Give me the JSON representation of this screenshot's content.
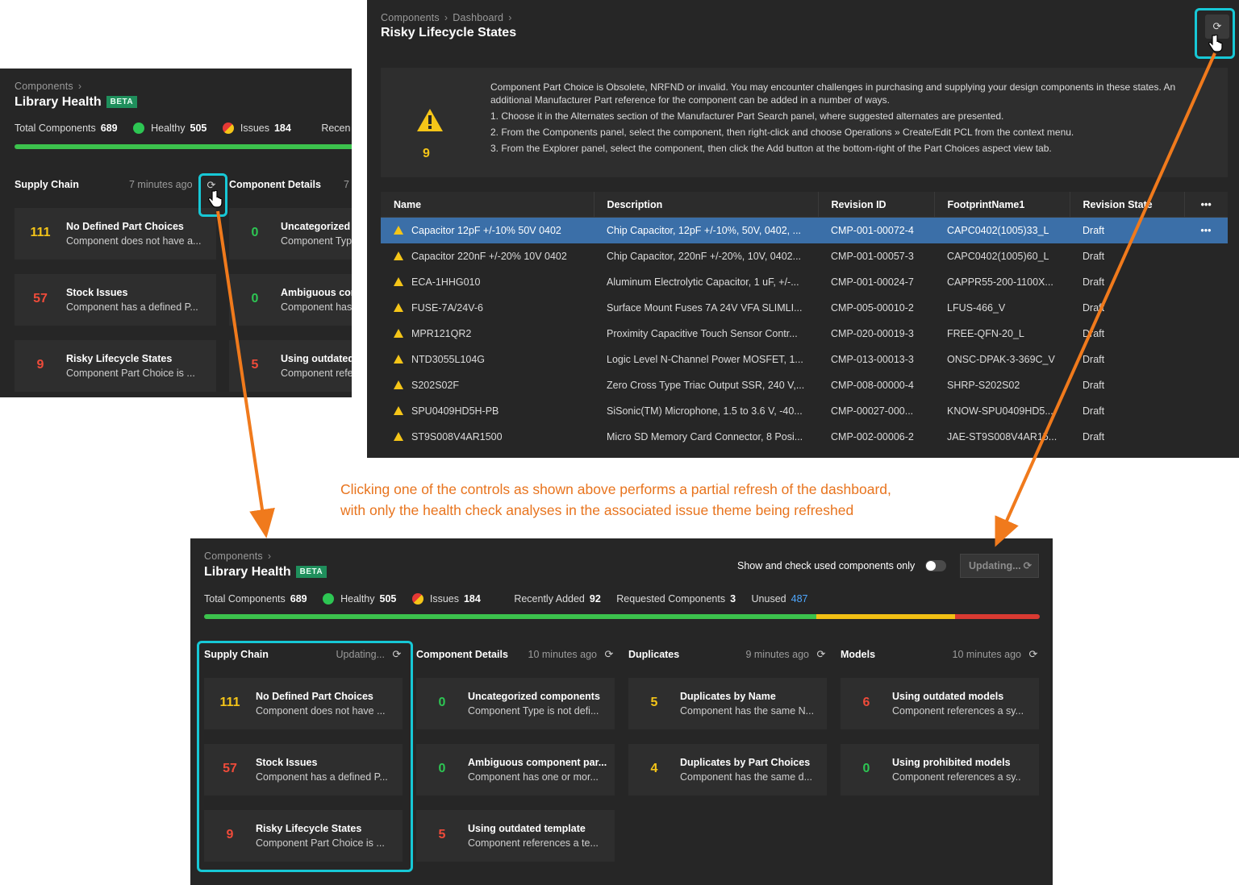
{
  "shared": {
    "breadcrumb_root": "Components",
    "beta": "BETA",
    "labels": {
      "total": "Total Components",
      "healthy": "Healthy",
      "issues": "Issues",
      "recent_short": "Recen",
      "recent": "Recently Added",
      "requested": "Requested Components",
      "unused": "Unused"
    },
    "values": {
      "total": "689",
      "healthy": "505",
      "issues": "184",
      "recent": "92",
      "requested": "3",
      "unused": "487"
    },
    "colors": {
      "accent_highlight": "#17c8d6",
      "callout": "#e8741e",
      "selected_row": "#3b6fa8",
      "bar_green": "#3cc24d",
      "bar_yellow": "#f2c014",
      "bar_red": "#d93a32"
    },
    "bar_segments_percent": {
      "healthy": 73.3,
      "warnings": 16.6,
      "errors": 10.1
    }
  },
  "left_panel": {
    "title": "Library Health",
    "supply_chain": {
      "name": "Supply Chain",
      "time": "7 minutes ago"
    },
    "component_details": {
      "name": "Component Details",
      "time": "7"
    },
    "cards": [
      {
        "count": "111",
        "title": "No Defined Part Choices",
        "desc": "Component does not have a..."
      },
      {
        "count": "57",
        "title": "Stock Issues",
        "desc": "Component has a defined P..."
      },
      {
        "count": "9",
        "title": "Risky Lifecycle States",
        "desc": "Component Part Choice is ..."
      },
      {
        "count": "0",
        "title": "Uncategorized",
        "desc": "Component Typ"
      },
      {
        "count": "0",
        "title": "Ambiguous com",
        "desc": "Component has"
      },
      {
        "count": "5",
        "title": "Using outdated",
        "desc": "Component refe"
      }
    ]
  },
  "right_panel": {
    "breadcrumb_mid": "Dashboard",
    "title": "Risky Lifecycle States",
    "info_count": "9",
    "info_intro": "Component Part Choice is Obsolete, NRFND or invalid. You may encounter challenges in purchasing and supplying your design components in these states. An additional Manufacturer Part reference for the component can be added in a number of ways.",
    "info_steps": [
      "1. Choose it in the Alternates section of the Manufacturer Part Search panel, where suggested alternates are presented.",
      "2. From the Components panel, select the component, then right-click and choose Operations » Create/Edit PCL from the context menu.",
      "3. From the Explorer panel, select the component, then click the Add button at the bottom-right of the Part Choices aspect view tab."
    ],
    "table": {
      "headers": [
        "Name",
        "Description",
        "Revision ID",
        "FootprintName1",
        "Revision State"
      ],
      "more": "•••",
      "rows": [
        [
          "Capacitor 12pF +/-10% 50V 0402",
          "Chip Capacitor, 12pF +/-10%, 50V, 0402, ...",
          "CMP-001-00072-4",
          "CAPC0402(1005)33_L",
          "Draft"
        ],
        [
          "Capacitor 220nF +/-20% 10V 0402",
          "Chip Capacitor, 220nF +/-20%, 10V, 0402...",
          "CMP-001-00057-3",
          "CAPC0402(1005)60_L",
          "Draft"
        ],
        [
          "ECA-1HHG010",
          "Aluminum Electrolytic Capacitor, 1 uF, +/-...",
          "CMP-001-00024-7",
          "CAPPR55-200-1100X...",
          "Draft"
        ],
        [
          "FUSE-7A/24V-6",
          "Surface Mount Fuses 7A 24V VFA SLIMLI...",
          "CMP-005-00010-2",
          "LFUS-466_V",
          "Draft"
        ],
        [
          "MPR121QR2",
          "Proximity Capacitive Touch Sensor Contr...",
          "CMP-020-00019-3",
          "FREE-QFN-20_L",
          "Draft"
        ],
        [
          "NTD3055L104G",
          "Logic Level N-Channel Power MOSFET, 1...",
          "CMP-013-00013-3",
          "ONSC-DPAK-3-369C_V",
          "Draft"
        ],
        [
          "S202S02F",
          "Zero Cross Type Triac Output SSR, 240 V,...",
          "CMP-008-00000-4",
          "SHRP-S202S02",
          "Draft"
        ],
        [
          "SPU0409HD5H-PB",
          "SiSonic(TM) Microphone, 1.5 to 3.6 V, -40...",
          "CMP-00027-000...",
          "KNOW-SPU0409HD5...",
          "Draft"
        ],
        [
          "ST9S008V4AR1500",
          "Micro SD Memory Card Connector, 8 Posi...",
          "CMP-002-00006-2",
          "JAE-ST9S008V4AR15...",
          "Draft"
        ]
      ]
    }
  },
  "caption": {
    "line1": "Clicking one of the controls as shown above performs a partial refresh of the dashboard,",
    "line2": "with only the health check analyses in the associated issue theme being refreshed"
  },
  "bottom_panel": {
    "title": "Library Health",
    "toggle_label": "Show and check used components only",
    "updating_button": "Updating...",
    "sections": [
      {
        "name": "Supply Chain",
        "time": "Updating...",
        "cards": [
          {
            "count": "111",
            "title": "No Defined Part Choices",
            "desc": "Component does not have ..."
          },
          {
            "count": "57",
            "title": "Stock Issues",
            "desc": "Component has a defined P..."
          },
          {
            "count": "9",
            "title": "Risky Lifecycle States",
            "desc": "Component Part Choice is ..."
          }
        ]
      },
      {
        "name": "Component Details",
        "time": "10 minutes ago",
        "cards": [
          {
            "count": "0",
            "title": "Uncategorized components",
            "desc": "Component Type is not defi..."
          },
          {
            "count": "0",
            "title": "Ambiguous component par...",
            "desc": "Component has one or mor..."
          },
          {
            "count": "5",
            "title": "Using outdated template",
            "desc": "Component references a te..."
          }
        ]
      },
      {
        "name": "Duplicates",
        "time": "9 minutes ago",
        "cards": [
          {
            "count": "5",
            "title": "Duplicates by Name",
            "desc": "Component has the same N..."
          },
          {
            "count": "4",
            "title": "Duplicates by Part Choices",
            "desc": "Component has the same d..."
          }
        ]
      },
      {
        "name": "Models",
        "time": "10 minutes ago",
        "cards": [
          {
            "count": "6",
            "title": "Using outdated models",
            "desc": "Component references a sy..."
          },
          {
            "count": "0",
            "title": "Using prohibited models",
            "desc": "Component references a sy.."
          }
        ]
      }
    ]
  }
}
